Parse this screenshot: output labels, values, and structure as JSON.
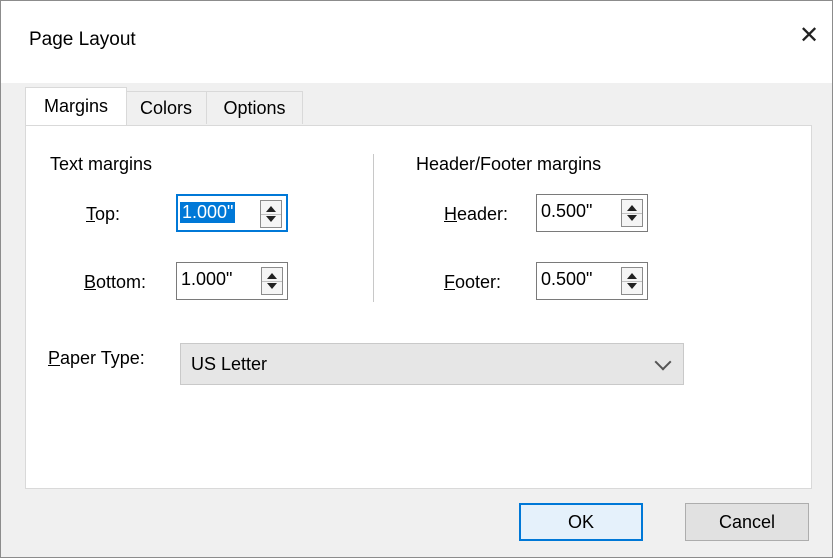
{
  "window": {
    "title": "Page Layout",
    "close_glyph": "✕"
  },
  "tabs": [
    {
      "label": "Margins",
      "active": true
    },
    {
      "label": "Colors",
      "active": false
    },
    {
      "label": "Options",
      "active": false
    }
  ],
  "text_margins": {
    "heading": "Text margins",
    "top": {
      "mnemonic": "T",
      "label_rest": "op:",
      "value": "1.000\""
    },
    "bottom": {
      "mnemonic": "B",
      "label_rest": "ottom:",
      "value": "1.000\""
    }
  },
  "header_footer_margins": {
    "heading": "Header/Footer margins",
    "header": {
      "mnemonic": "H",
      "label_rest": "eader:",
      "value": "0.500\""
    },
    "footer": {
      "mnemonic": "F",
      "label_rest": "ooter:",
      "value": "0.500\""
    }
  },
  "paper_type": {
    "mnemonic": "P",
    "label_rest": "aper Type:",
    "value": "US Letter"
  },
  "buttons": {
    "ok": "OK",
    "cancel": "Cancel"
  },
  "colors": {
    "accent": "#0078d7",
    "dialog_bg": "#f0f0f0",
    "panel_bg": "#ffffff"
  }
}
